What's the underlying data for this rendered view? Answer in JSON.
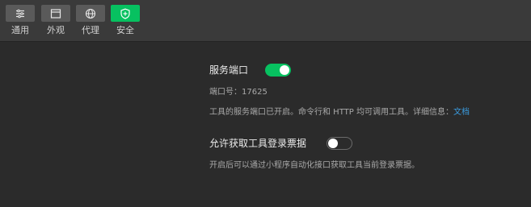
{
  "tabs": [
    {
      "label": "通用",
      "icon": "sliders-icon"
    },
    {
      "label": "外观",
      "icon": "window-icon"
    },
    {
      "label": "代理",
      "icon": "globe-icon"
    },
    {
      "label": "安全",
      "icon": "shield-icon"
    }
  ],
  "active_tab": "安全",
  "service_port": {
    "title": "服务端口",
    "enabled": true,
    "port_text": "端口号：17625",
    "description": "工具的服务端口已开启。命令行和 HTTP 均可调用工具。详细信息：",
    "link_text": "文档"
  },
  "login_ticket": {
    "title": "允许获取工具登录票据",
    "enabled": false,
    "description": "开启后可以通过小程序自动化接口获取工具当前登录票据。"
  },
  "colors": {
    "accent": "#07c160",
    "background": "#2b2b2b",
    "toolbar": "#3a3a3a",
    "link": "#3a9bde"
  }
}
